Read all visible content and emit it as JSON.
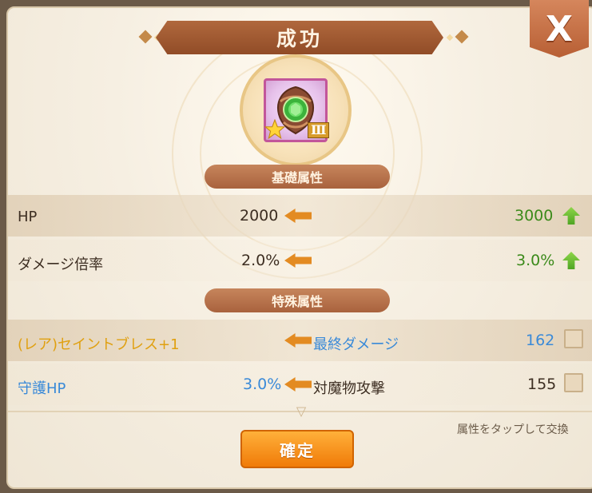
{
  "dialog": {
    "title": "成功",
    "close_label": "X",
    "close_icon": "close-icon"
  },
  "item": {
    "icon": "gem-emblem-icon",
    "star_icon": "star-icon",
    "grade": "Ⅲ"
  },
  "basic": {
    "header": "基礎属性",
    "rows": [
      {
        "label": "HP",
        "before": "2000",
        "after": "3000"
      },
      {
        "label": "ダメージ倍率",
        "before": "2.0%",
        "after": "3.0%"
      }
    ]
  },
  "special": {
    "header": "特殊属性",
    "rows": [
      {
        "left_label": "(レア)セイントブレス+1",
        "left_value": "",
        "stat": "最終ダメージ",
        "value": "162"
      },
      {
        "left_label": "守護HP",
        "left_value": "3.0%",
        "stat": "対魔物攻撃",
        "value": "155"
      }
    ]
  },
  "footer": {
    "hint": "属性をタップして交換",
    "confirm_label": "確定"
  },
  "colors": {
    "rare_gold": "#e0a010",
    "stat_blue": "#3a8ad8",
    "green_up": "#3b8a1a",
    "arrow_orange": "#e38b22"
  }
}
